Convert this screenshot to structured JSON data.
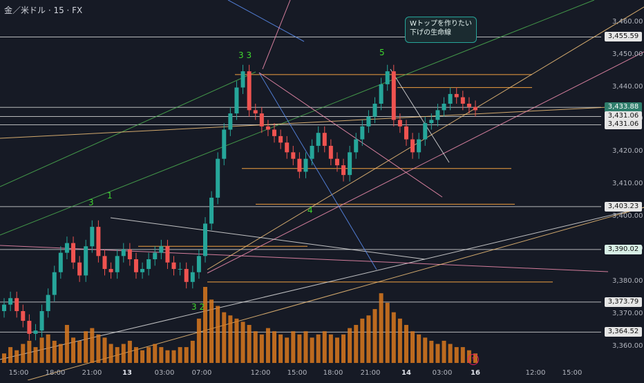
{
  "header": {
    "title": "金／米ドル · 15 · FX"
  },
  "callout": {
    "line1": "Wトップを作りたい",
    "line2": "下げの生命線"
  },
  "price_labels": [
    {
      "text": "3,455.59",
      "value": 3455.59,
      "style": "white"
    },
    {
      "text": "3,433.88",
      "value": 3433.88,
      "style": "green"
    },
    {
      "text": "3,431.06",
      "value": 3431.06,
      "style": "white"
    },
    {
      "text": "3,431.06",
      "value": 3428.5,
      "style": "white"
    },
    {
      "text": "3,403.23",
      "value": 3403.23,
      "style": "white"
    },
    {
      "text": "3,390.02",
      "value": 3390.02,
      "style": "mint"
    },
    {
      "text": "3,373.79",
      "value": 3373.79,
      "style": "white"
    },
    {
      "text": "3,364.52",
      "value": 3364.52,
      "style": "white"
    }
  ],
  "notes": [
    {
      "text": "3",
      "x": "18:00"
    },
    {
      "text": "1",
      "x": "13"
    },
    {
      "text": "3 3",
      "x": "12:00"
    },
    {
      "text": "3 2",
      "x": "07:00"
    },
    {
      "text": "4",
      "x": "18:00"
    },
    {
      "text": "5",
      "x": "21:00"
    }
  ],
  "badge": {
    "icon": "lightning-icon"
  },
  "colors": {
    "up": "#26a69a",
    "down": "#ef5350",
    "volume": "#d9791f",
    "background": "#161a25"
  },
  "chart_data": {
    "type": "candlestick",
    "title": "金／米ドル · 15 · FX",
    "ylim": [
      3355,
      3467
    ],
    "y_ticks": [
      3360,
      3370,
      3380,
      3390,
      3400,
      3410,
      3420,
      3430,
      3440,
      3450,
      3460
    ],
    "x_ticks": [
      "15:00",
      "18:00",
      "21:00",
      "13",
      "03:00",
      "07:00",
      "12:00",
      "15:00",
      "18:00",
      "21:00",
      "14",
      "03:00",
      "16",
      "12:00",
      "15:00"
    ],
    "grid": false,
    "series": [
      {
        "values": [
          3373,
          3375,
          3371,
          3368,
          3364,
          3365,
          3371,
          3376,
          3383,
          3389,
          3392,
          3386,
          3382,
          3391,
          3397,
          3388,
          3384,
          3383,
          3388,
          3390,
          3387,
          3383,
          3384,
          3387,
          3389,
          3391,
          3386,
          3384,
          3384,
          3380,
          3383,
          3388,
          3398,
          3406,
          3418,
          3427,
          3432,
          3440,
          3445,
          3433,
          3432,
          3428,
          3427,
          3425,
          3423,
          3420,
          3418,
          3414,
          3418,
          3422,
          3426,
          3422,
          3418,
          3416,
          3413,
          3420,
          3424,
          3428,
          3431,
          3435,
          3441,
          3445,
          3430,
          3428,
          3424,
          3420,
          3424,
          3429,
          3430,
          3433,
          3435,
          3438,
          3437,
          3435,
          3434,
          3433
        ]
      },
      {
        "values": [
          3,
          5,
          4,
          6,
          7,
          5,
          8,
          9,
          7,
          6,
          12,
          8,
          7,
          10,
          11,
          9,
          8,
          6,
          5,
          6,
          7,
          5,
          4,
          5,
          6,
          5,
          4,
          4,
          5,
          5,
          7,
          14,
          24,
          20,
          18,
          16,
          15,
          14,
          13,
          12,
          10,
          9,
          11,
          10,
          9,
          8,
          10,
          9,
          10,
          8,
          9,
          10,
          9,
          8,
          9,
          11,
          12,
          14,
          15,
          17,
          22,
          19,
          16,
          14,
          12,
          10,
          9,
          8,
          7,
          6,
          7,
          6,
          5,
          5,
          4,
          3
        ]
      }
    ]
  }
}
